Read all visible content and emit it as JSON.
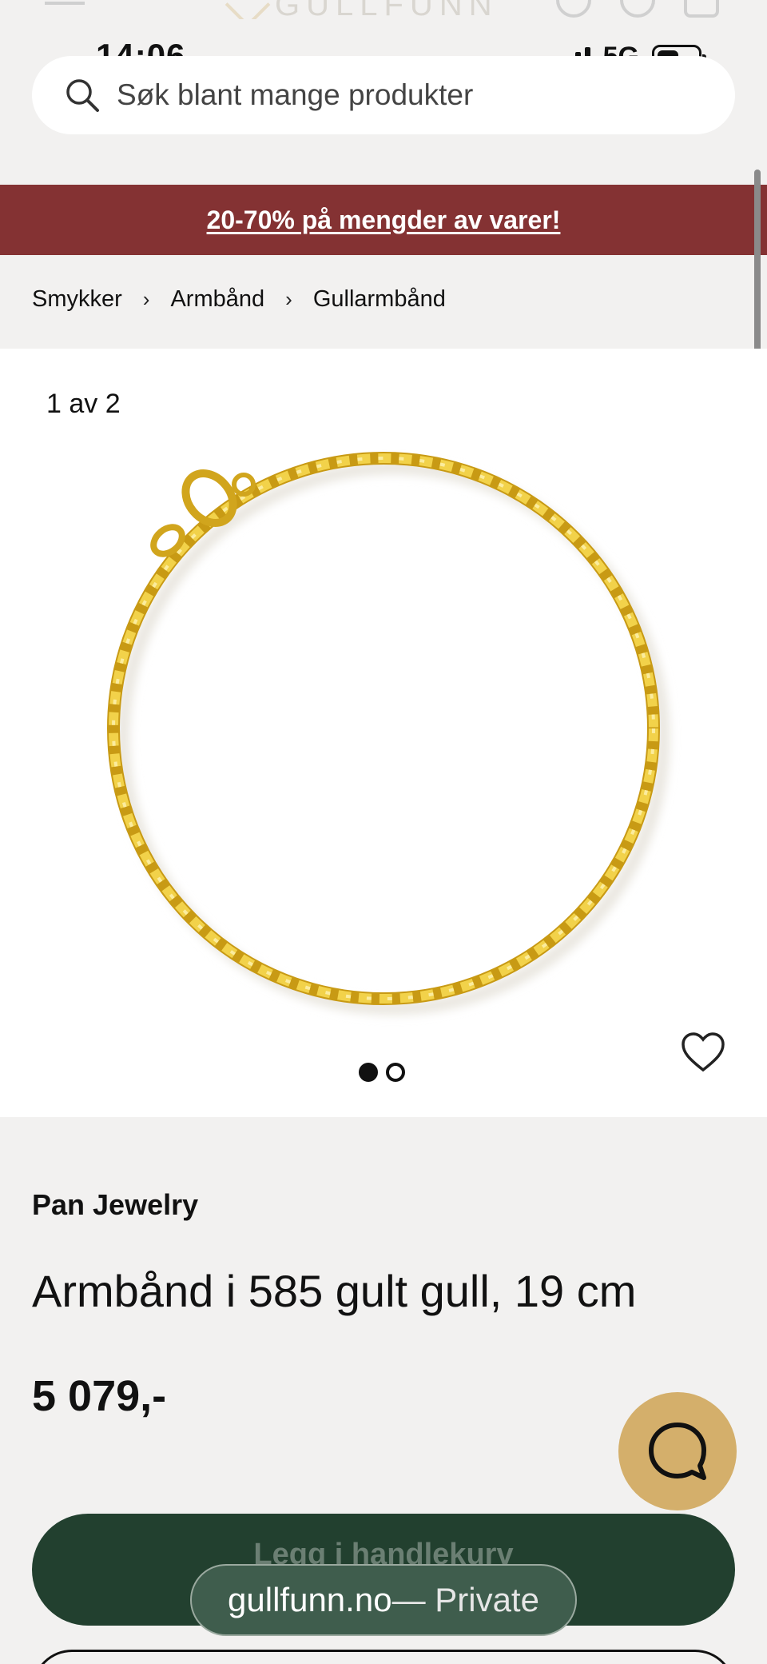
{
  "header": {
    "logo_text": "GULLFUNN"
  },
  "status_bar": {
    "time": "14:06",
    "network": "5G"
  },
  "search": {
    "placeholder": "Søk blant mange produkter"
  },
  "promo": {
    "text": "20-70% på mengder av varer!"
  },
  "breadcrumb": {
    "items": [
      "Smykker",
      "Armbånd",
      "Gullarmbånd"
    ],
    "separator": "›"
  },
  "gallery": {
    "counter": "1 av 2",
    "current_page": 1,
    "total_pages": 2
  },
  "product": {
    "brand": "Pan Jewelry",
    "title": "Armbånd i 585 gult gull, 19 cm",
    "price": "5 079,-"
  },
  "cart_button": {
    "label": "Legg i handlekurv"
  },
  "browser": {
    "domain": "gullfunn.no",
    "mode": " — Private"
  },
  "colors": {
    "promo": "#843233",
    "cart_button": "#22402f",
    "chat_button": "#d4af6b",
    "chain_gold": "#e3b92a"
  },
  "icons": [
    "menu-icon",
    "user-icon",
    "heart-icon",
    "cart-icon",
    "search-icon",
    "chevron-right-icon",
    "chat-icon"
  ]
}
